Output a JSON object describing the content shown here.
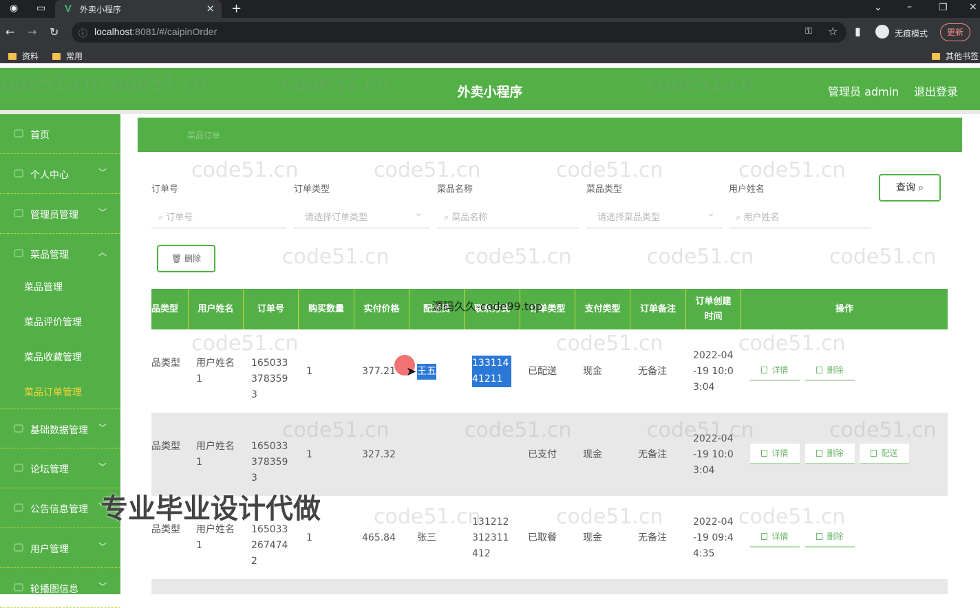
{
  "browser": {
    "tab_title": "外卖小程序",
    "url_host": "localhost",
    "url_rest": ":8081/#/caipinOrder",
    "incognito_label": "无痕模式",
    "update_label": "更新",
    "bookmarks": [
      "资料",
      "常用"
    ],
    "other_bookmarks": "其他书签"
  },
  "header": {
    "title": "外卖小程序",
    "user": "管理员 admin",
    "logout": "退出登录"
  },
  "sidebar": {
    "items": [
      {
        "label": "首页"
      },
      {
        "label": "个人中心"
      },
      {
        "label": "管理员管理"
      },
      {
        "label": "菜品管理"
      },
      {
        "label": "基础数据管理"
      },
      {
        "label": "论坛管理"
      },
      {
        "label": "公告信息管理"
      },
      {
        "label": "用户管理"
      },
      {
        "label": "轮播图信息"
      }
    ],
    "subitems": [
      {
        "label": "菜品管理"
      },
      {
        "label": "菜品评价管理"
      },
      {
        "label": "菜品收藏管理"
      },
      {
        "label": "菜品订单管理"
      }
    ]
  },
  "breadcrumb": "菜品订单",
  "filters": {
    "labels": [
      "订单号",
      "订单类型",
      "菜品名称",
      "菜品类型",
      "用户姓名"
    ],
    "placeholders": [
      "订单号",
      "请选择订单类型",
      "菜品名称",
      "请选择菜品类型",
      "用户姓名"
    ],
    "query_button": "查询",
    "delete_button": "删除"
  },
  "table": {
    "headers": [
      "品类型",
      "用户姓名",
      "订单号",
      "购买数量",
      "实付价格",
      "配送员",
      "联系方式",
      "订单类型",
      "支付类型",
      "订单备注",
      "订单创建时间",
      "操作"
    ],
    "rows": [
      {
        "type": "品类型",
        "user": "用户姓名1",
        "order_no": "1650333783593",
        "qty": "1",
        "price": "377.21",
        "courier": "王五",
        "phone": "13311441211",
        "status": "已配送",
        "pay": "现金",
        "note": "无备注",
        "time": "2022-04-19 10:03:04",
        "actions": [
          "详情",
          "删除"
        ]
      },
      {
        "type": "品类型",
        "user": "用户姓名1",
        "order_no": "1650333783593",
        "qty": "1",
        "price": "327.32",
        "courier": "",
        "phone": "",
        "status": "已支付",
        "pay": "现金",
        "note": "无备注",
        "time": "2022-04-19 10:03:04",
        "actions": [
          "详情",
          "删除",
          "配送"
        ]
      },
      {
        "type": "品类型",
        "user": "用户姓名1",
        "order_no": "1650332674742",
        "qty": "1",
        "price": "465.84",
        "courier": "张三",
        "phone": "131212312311412",
        "status": "已取餐",
        "pay": "现金",
        "note": "无备注",
        "time": "2022-04-19 09:44:35",
        "actions": [
          "详情",
          "删除"
        ]
      }
    ]
  },
  "overlays": {
    "watermark": "code51.cn",
    "source_text": "源码久久-code99.top",
    "promo": "专业毕业设计代做"
  },
  "colors": {
    "primary": "#52b046",
    "menu_active": "#f5d33b",
    "selection": "#2b78d7"
  }
}
